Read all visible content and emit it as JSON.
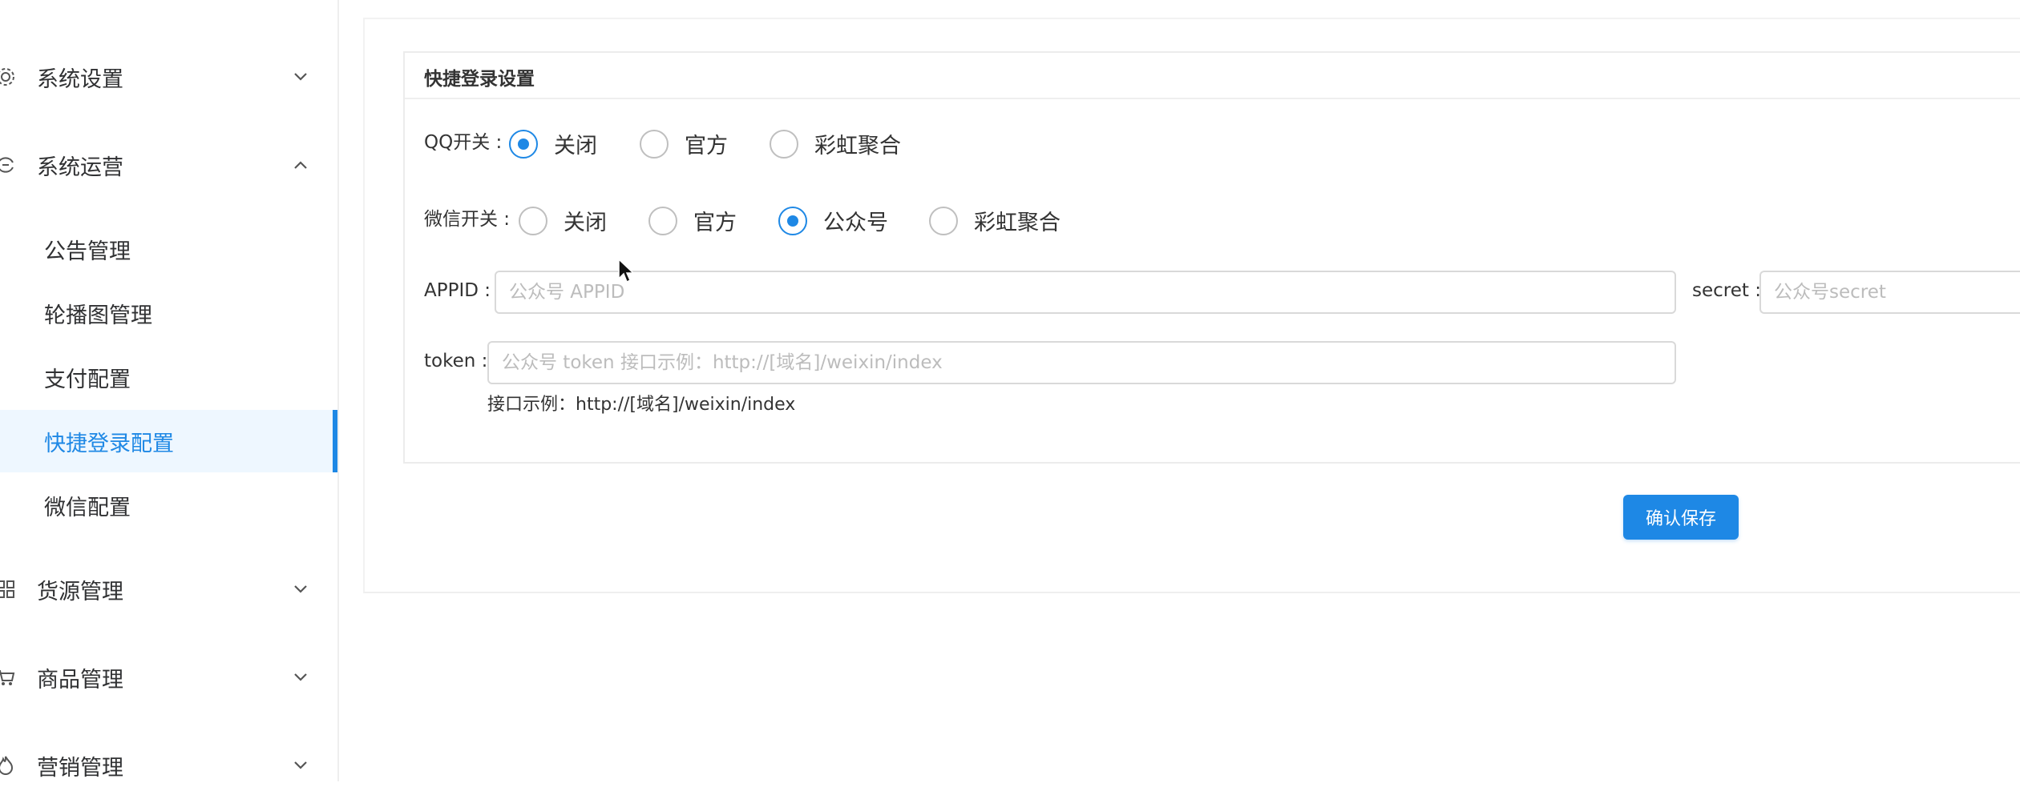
{
  "sidebar": {
    "groups": [
      {
        "label": "系统设置",
        "icon": "gear-icon",
        "expanded": false
      },
      {
        "label": "系统运营",
        "icon": "operations-icon",
        "expanded": true
      },
      {
        "label": "货源管理",
        "icon": "grid-icon",
        "expanded": false
      },
      {
        "label": "商品管理",
        "icon": "cart-icon",
        "expanded": false
      },
      {
        "label": "营销管理",
        "icon": "fire-icon",
        "expanded": false
      }
    ],
    "sub_items": [
      {
        "label": "公告管理"
      },
      {
        "label": "轮播图管理"
      },
      {
        "label": "支付配置"
      },
      {
        "label": "快捷登录配置",
        "active": true
      },
      {
        "label": "微信配置"
      }
    ]
  },
  "card": {
    "title": "快捷登录设置"
  },
  "qq": {
    "label": "QQ开关 :",
    "options": [
      "关闭",
      "官方",
      "彩虹聚合"
    ],
    "selected": "关闭"
  },
  "wechat": {
    "label": "微信开关 :",
    "options": [
      "关闭",
      "官方",
      "公众号",
      "彩虹聚合"
    ],
    "selected": "公众号"
  },
  "appid": {
    "label": "APPID :",
    "value": "",
    "placeholder": "公众号 APPID"
  },
  "secret": {
    "label": "secret :",
    "value": "",
    "placeholder": "公众号secret"
  },
  "token": {
    "label": "token :",
    "value": "",
    "placeholder": "公众号 token 接口示例：http://[域名]/weixin/index",
    "hint": "接口示例：http://[域名]/weixin/index"
  },
  "actions": {
    "save_label": "确认保存"
  },
  "colors": {
    "accent": "#1e88e5",
    "active_bg": "#eef7ff",
    "border": "#d9d9d9"
  }
}
